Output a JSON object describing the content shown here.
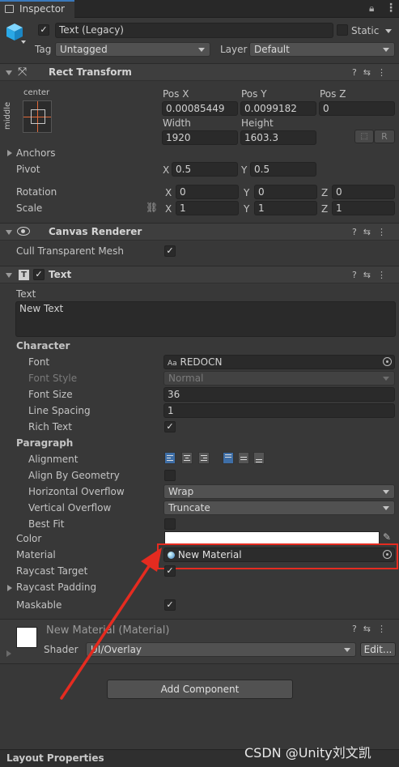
{
  "tab": {
    "title": "Inspector"
  },
  "gameobject": {
    "name": "Text (Legacy)",
    "static_label": "Static",
    "tag_label": "Tag",
    "tag_value": "Untagged",
    "layer_label": "Layer",
    "layer_value": "Default"
  },
  "rect_transform": {
    "title": "Rect Transform",
    "anchor_h": "center",
    "anchor_v": "middle",
    "pos_x_label": "Pos X",
    "pos_x": "0.00085449",
    "pos_y_label": "Pos Y",
    "pos_y": "0.0099182",
    "pos_z_label": "Pos Z",
    "pos_z": "0",
    "width_label": "Width",
    "width": "1920",
    "height_label": "Height",
    "height": "1603.3",
    "r_label": "R",
    "anchors_label": "Anchors",
    "pivot_label": "Pivot",
    "pivot_x": "0.5",
    "pivot_y": "0.5",
    "rotation_label": "Rotation",
    "rot_x": "0",
    "rot_y": "0",
    "rot_z": "0",
    "scale_label": "Scale",
    "scale_x": "1",
    "scale_y": "1",
    "scale_z": "1",
    "x": "X",
    "y": "Y",
    "z": "Z"
  },
  "canvas_renderer": {
    "title": "Canvas Renderer",
    "cull_label": "Cull Transparent Mesh"
  },
  "text": {
    "title": "Text",
    "text_label": "Text",
    "text_value": "New Text",
    "character_label": "Character",
    "font_label": "Font",
    "font_prefix": "Aa",
    "font_value": "REDOCN",
    "font_style_label": "Font Style",
    "font_style_value": "Normal",
    "font_size_label": "Font Size",
    "font_size_value": "36",
    "line_spacing_label": "Line Spacing",
    "line_spacing_value": "1",
    "rich_text_label": "Rich Text",
    "paragraph_label": "Paragraph",
    "alignment_label": "Alignment",
    "align_geometry_label": "Align By Geometry",
    "h_overflow_label": "Horizontal Overflow",
    "h_overflow_value": "Wrap",
    "v_overflow_label": "Vertical Overflow",
    "v_overflow_value": "Truncate",
    "best_fit_label": "Best Fit",
    "color_label": "Color",
    "material_label": "Material",
    "material_value": "New Material",
    "raycast_target_label": "Raycast Target",
    "raycast_padding_label": "Raycast Padding",
    "maskable_label": "Maskable"
  },
  "material": {
    "title": "New Material (Material)",
    "shader_label": "Shader",
    "shader_value": "UI/Overlay",
    "edit_label": "Edit..."
  },
  "add_component": {
    "label": "Add Component"
  },
  "footer": {
    "label": "Layout Properties"
  },
  "watermark": "CSDN @Unity刘文凯",
  "colors": {
    "highlight": "#e52b20",
    "accent": "#3e6ea6",
    "bg": "#383838"
  }
}
